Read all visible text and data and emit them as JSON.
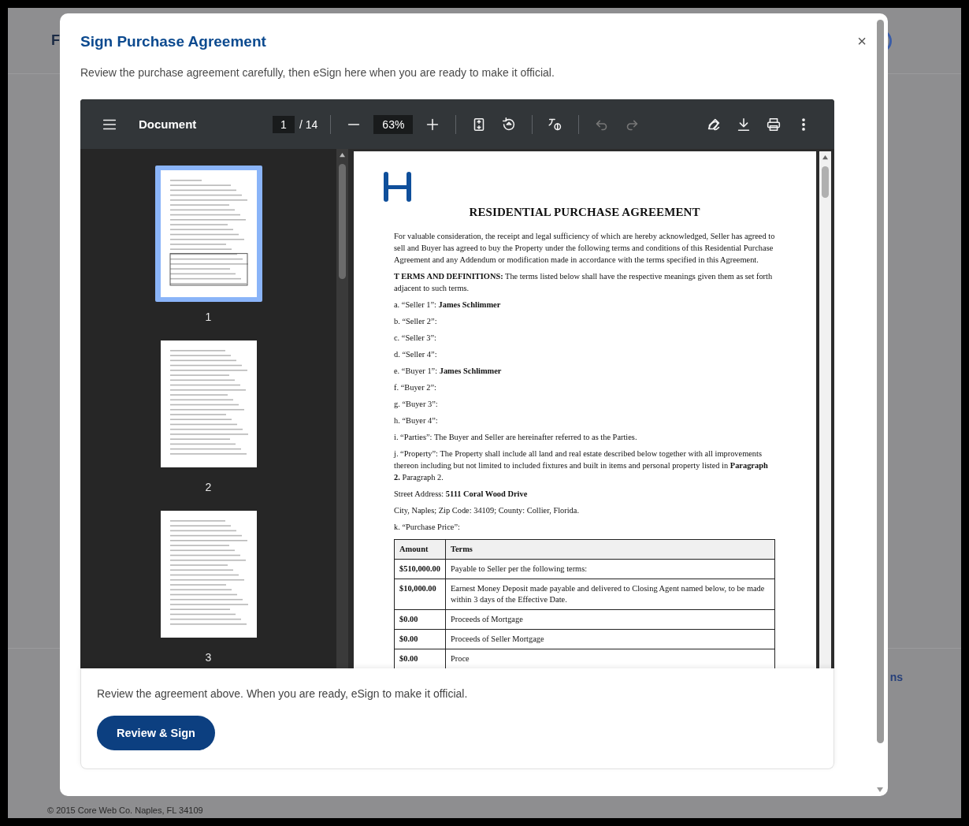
{
  "background": {
    "header_fragment": "F",
    "link_fragment": "ns",
    "copyright": "© 2015 Core Web Co. Naples, FL 34109"
  },
  "modal": {
    "title": "Sign Purchase Agreement",
    "close": "×",
    "intro": "Review the purchase agreement carefully, then eSign here when you are ready to make it official."
  },
  "toolbar": {
    "title": "Document",
    "page": "1",
    "page_total": "/ 14",
    "zoom": "63%",
    "view_tools": [
      {
        "kind": "fit-page"
      },
      {
        "kind": "rotate"
      }
    ],
    "history": [
      {
        "kind": "undo",
        "disabled": true
      },
      {
        "kind": "redo",
        "disabled": true
      }
    ],
    "actions": [
      {
        "kind": "annotate"
      },
      {
        "kind": "download"
      },
      {
        "kind": "print"
      },
      {
        "kind": "more"
      }
    ]
  },
  "thumbnails": [
    {
      "label": "1",
      "selected": true
    },
    {
      "label": "2",
      "selected": false
    },
    {
      "label": "3",
      "selected": false
    }
  ],
  "document": {
    "title": "RESIDENTIAL PURCHASE AGREEMENT",
    "paragraphs": [
      "For valuable consideration, the receipt and legal sufficiency of which are hereby acknowledged, Seller has agreed to sell and Buyer has agreed to buy the Property under the following terms and conditions of this Residential Purchase Agreement and any Addendum or modification made in accordance with the terms specified in this Agreement.",
      "**T ERMS AND DEFINITIONS:** The terms listed below shall have the respective meanings given them as set forth adjacent to such terms.",
      "a. “Seller 1”: **James Schlimmer**",
      "b. “Seller 2”:",
      "c. “Seller 3”:",
      "d. “Seller 4”:",
      "e. “Buyer 1”: **James Schlimmer**",
      "f. “Buyer 2”:",
      "g. “Buyer 3”:",
      "h. “Buyer 4”:",
      "i. “Parties”: The Buyer and Seller are hereinafter referred to as the Parties.",
      "j. “Property”: The Property shall include all land and real estate described below together with all improvements thereon including but not limited to included fixtures and built in items and personal property listed in **Paragraph 2.** Paragraph 2.",
      "Street Address: **5111 Coral Wood Drive**",
      "City, Naples; Zip Code: 34109; County: Collier, Florida.",
      "k. “Purchase Price”:"
    ],
    "table": {
      "columns": [
        "Amount",
        "Terms"
      ],
      "rows": [
        {
          "amount": "$510,000.00",
          "terms": "Payable to Seller per the following terms:"
        },
        {
          "amount": "$10,000.00",
          "terms": "Earnest Money Deposit made payable and delivered to Closing Agent named below, to be made within 3 days of the Effective Date."
        },
        {
          "amount": "$0.00",
          "terms": "Proceeds of Mortgage"
        },
        {
          "amount": "$0.00",
          "terms": "Proceeds of Seller Mortgage"
        },
        {
          "amount": "$0.00",
          "terms": "Proce"
        }
      ]
    }
  },
  "footer": {
    "note": "Review the agreement above. When you are ready, eSign to make it official.",
    "button": "Review & Sign"
  }
}
